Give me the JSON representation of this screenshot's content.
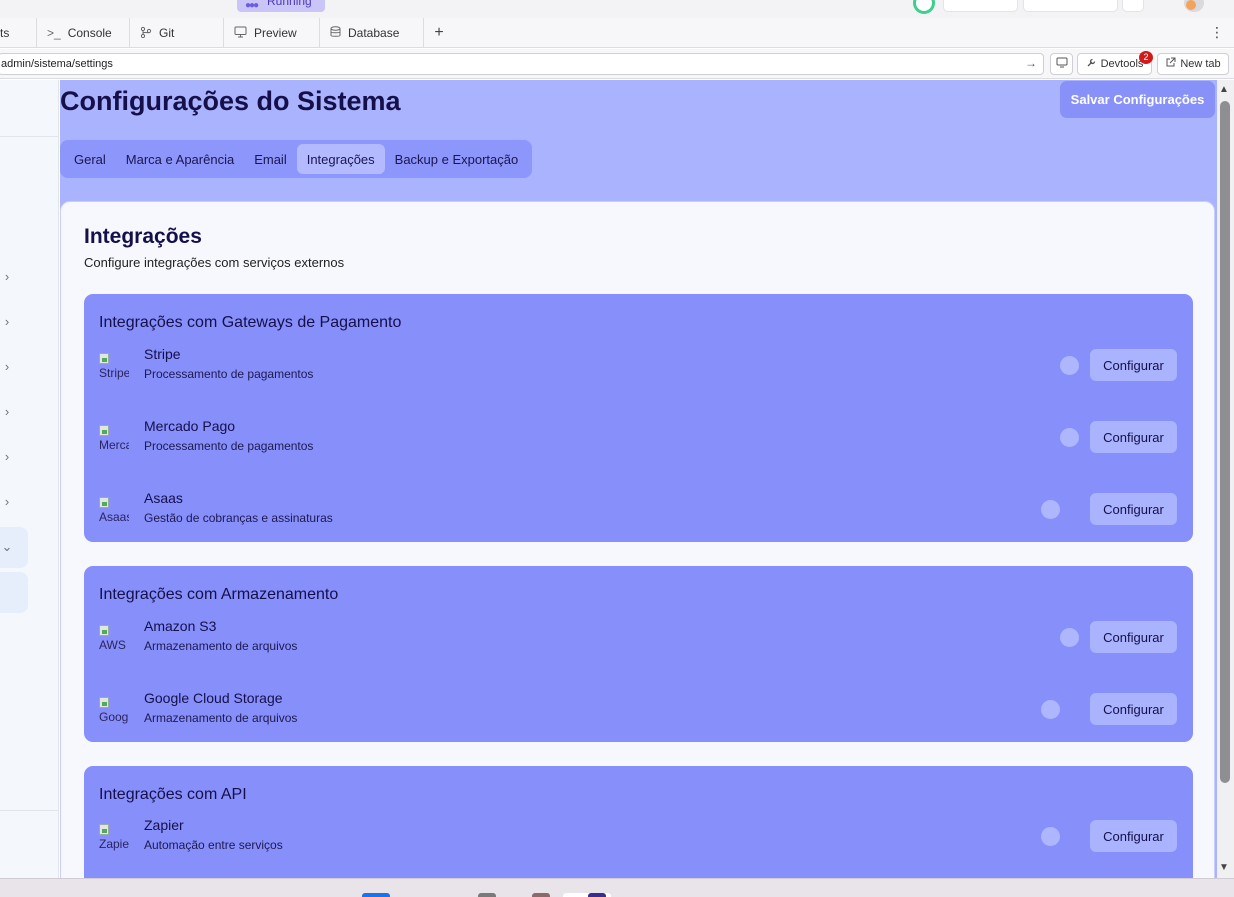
{
  "top": {
    "status_label": "Running"
  },
  "ide_tabs": [
    {
      "label": "ts",
      "icon": "terminal-icon"
    },
    {
      "label": "Console",
      "icon": "terminal-prompt-icon"
    },
    {
      "label": "Git",
      "icon": "git-branch-icon"
    },
    {
      "label": "Preview",
      "icon": "monitor-icon"
    },
    {
      "label": "Database",
      "icon": "database-icon"
    }
  ],
  "url_bar": {
    "url": "admin/sistema/settings",
    "devtools_label": "Devtools",
    "devtools_badge": "2",
    "new_tab_label": "New tab"
  },
  "page": {
    "title": "Configurações do Sistema",
    "save_button": "Salvar Configurações",
    "tabs": [
      {
        "label": "Geral",
        "active": false
      },
      {
        "label": "Marca e Aparência",
        "active": false
      },
      {
        "label": "Email",
        "active": false
      },
      {
        "label": "Integrações",
        "active": true
      },
      {
        "label": "Backup e Exportação",
        "active": false
      }
    ]
  },
  "section": {
    "title": "Integrações",
    "subtitle": "Configure integrações com serviços externos",
    "configure_label": "Configurar"
  },
  "groups": [
    {
      "title": "Integrações com Gateways de Pagamento",
      "items": [
        {
          "logo_alt": "Stripe",
          "name": "Stripe",
          "description": "Processamento de pagamentos",
          "enabled": false
        },
        {
          "logo_alt": "Mercado Pago",
          "name": "Mercado Pago",
          "description": "Processamento de pagamentos",
          "enabled": false
        },
        {
          "logo_alt": "Asaas",
          "name": "Asaas",
          "description": "Gestão de cobranças e assinaturas",
          "enabled": false
        }
      ]
    },
    {
      "title": "Integrações com Armazenamento",
      "items": [
        {
          "logo_alt": "AWS",
          "name": "Amazon S3",
          "description": "Armazenamento de arquivos",
          "enabled": false
        },
        {
          "logo_alt": "Google",
          "name": "Google Cloud Storage",
          "description": "Armazenamento de arquivos",
          "enabled": false
        }
      ]
    },
    {
      "title": "Integrações com API",
      "items": [
        {
          "logo_alt": "Zapier",
          "name": "Zapier",
          "description": "Automação entre serviços",
          "enabled": false
        }
      ]
    }
  ],
  "colors": {
    "main_bg": "#aab3fd",
    "group_bg": "#868ffa",
    "title_text": "#15104a",
    "save_button_bg": "#8891f8"
  }
}
